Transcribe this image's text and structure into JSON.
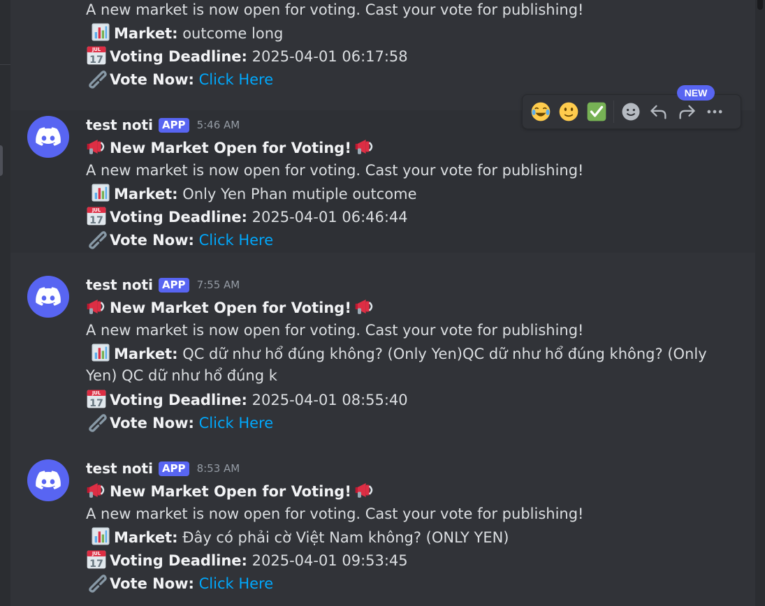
{
  "top_partial": {
    "intro": "A new market is now open for voting. Cast your vote for publishing!",
    "market_label": "Market:",
    "market_value": " outcome long",
    "deadline_label": "Voting Deadline:",
    "deadline_value": "2025-04-01 06:17:58",
    "vote_label": "Vote Now:",
    "vote_link": "Click Here"
  },
  "messages": [
    {
      "username": "test noti",
      "badge": "APP",
      "time": "5:46 AM",
      "title": "New Market Open for Voting!",
      "intro": "A new market is now open for voting. Cast your vote for publishing!",
      "market_label": "Market:",
      "market_value": " Only Yen Phan mutiple outcome",
      "deadline_label": "Voting Deadline:",
      "deadline_value": "2025-04-01 06:46:44",
      "vote_label": "Vote Now:",
      "vote_link": "Click Here"
    },
    {
      "username": "test noti",
      "badge": "APP",
      "time": "7:55 AM",
      "title": "New Market Open for Voting!",
      "intro": "A new market is now open for voting. Cast your vote for publishing!",
      "market_label": "Market:",
      "market_value": " QC dữ như hổ đúng không? (Only Yen)QC dữ như hổ đúng không? (Only",
      "market_value_cont": "Yen) QC dữ như hổ đúng k",
      "deadline_label": "Voting Deadline:",
      "deadline_value": "2025-04-01 08:55:40",
      "vote_label": "Vote Now:",
      "vote_link": "Click Here"
    },
    {
      "username": "test noti",
      "badge": "APP",
      "time": "8:53 AM",
      "title": "New Market Open for Voting!",
      "intro": "A new market is now open for voting. Cast your vote for publishing!",
      "market_label": "Market:",
      "market_value": " Đây có phải cờ Việt Nam không? (ONLY YEN)",
      "deadline_label": "Voting Deadline:",
      "deadline_value": "2025-04-01 09:53:45",
      "vote_label": "Vote Now:",
      "vote_link": "Click Here"
    }
  ],
  "toolbar": {
    "new_badge": "NEW",
    "calendar_month": "JUL",
    "calendar_day": "17",
    "items": [
      "joy-emoji",
      "slight-smile-emoji",
      "white-check-mark-emoji",
      "add-reaction-icon",
      "reply-icon",
      "forward-icon",
      "more-icon"
    ]
  },
  "colors": {
    "background": "#313338",
    "link": "#00a8fc",
    "brand": "#5865f2",
    "timestamp": "#949ba4"
  }
}
